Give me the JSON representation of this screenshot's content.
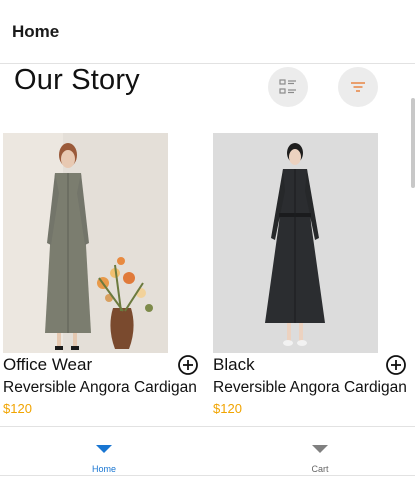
{
  "app_bar": {
    "title": "Home"
  },
  "page": {
    "title": "Our Story"
  },
  "actions": {
    "list_view_icon": "list-view-icon",
    "filter_icon": "filter-icon",
    "filter_color": "#e8762a"
  },
  "products": [
    {
      "name": "Office Wear",
      "subtitle": "Reversible Angora Cardigan",
      "price": "$120",
      "image": "model-grey-dress-photo"
    },
    {
      "name": "Black",
      "subtitle": "Reversible Angora Cardigan",
      "price": "$120",
      "image": "model-black-dress-photo"
    }
  ],
  "bottom_nav": {
    "items": [
      {
        "label": "Home",
        "icon": "triangle-down-icon",
        "active": true
      },
      {
        "label": "Cart",
        "icon": "triangle-down-icon",
        "active": false
      }
    ],
    "active_color": "#1976d2",
    "inactive_color": "#808080"
  },
  "colors": {
    "price": "#f1a400"
  }
}
